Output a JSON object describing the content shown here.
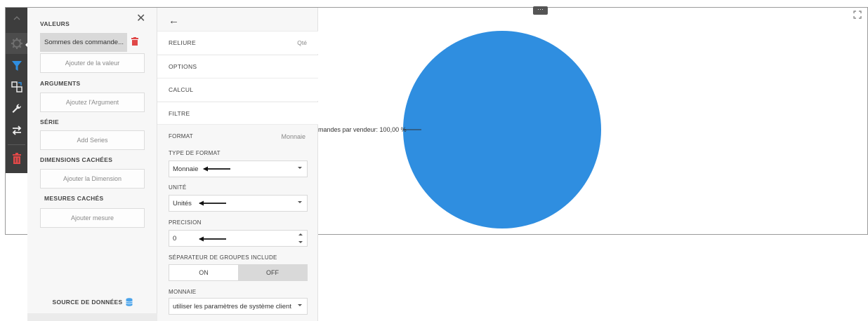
{
  "left_panel": {
    "values_title": "VALEURS",
    "value_item": "Sommes des commande...",
    "add_value": "Ajouter de la valeur",
    "arguments_title": "ARGUMENTS",
    "add_argument": "Ajoutez l'Argument",
    "series_title": "SÉRIE",
    "add_series": "Add Series",
    "hidden_dimensions_title": "DIMENSIONS CACHÉES",
    "add_dimension": "Ajouter la Dimension",
    "hidden_measures_title": "MESURES CACHÉS",
    "add_measure": "Ajouter mesure",
    "data_source": "SOURCE DE DONNÉES"
  },
  "right_panel": {
    "rows": [
      {
        "label": "RELIURE",
        "value": "Qté"
      },
      {
        "label": "OPTIONS",
        "value": ""
      },
      {
        "label": "CALCUL",
        "value": ""
      },
      {
        "label": "FILTRE",
        "value": ""
      }
    ],
    "format_label": "FORMAT",
    "format_value": "Monnaie",
    "format_type_label": "TYPE DE FORMAT",
    "format_type_value": "Monnaie",
    "unit_label": "UNITÉ",
    "unit_value": "Unités",
    "precision_label": "PRECISION",
    "precision_value": "0",
    "group_sep_label": "SÉPARATEUR DE GROUPES INCLUDE",
    "toggle_on": "ON",
    "toggle_off": "OFF",
    "currency_label": "MONNAIE",
    "currency_value": "utiliser les paramètres de système client"
  },
  "chart_data": {
    "type": "pie",
    "slices": [
      {
        "label": "mandes par vendeur: 100,00 %",
        "value": 100,
        "color": "#2f8ee0"
      }
    ],
    "legend": "none"
  },
  "colors": {
    "toolbar": "#3d3d3d",
    "filter_icon": "#2f8ee0",
    "trash_icon": "#e04848",
    "pie_fill": "#2f8ee0"
  }
}
